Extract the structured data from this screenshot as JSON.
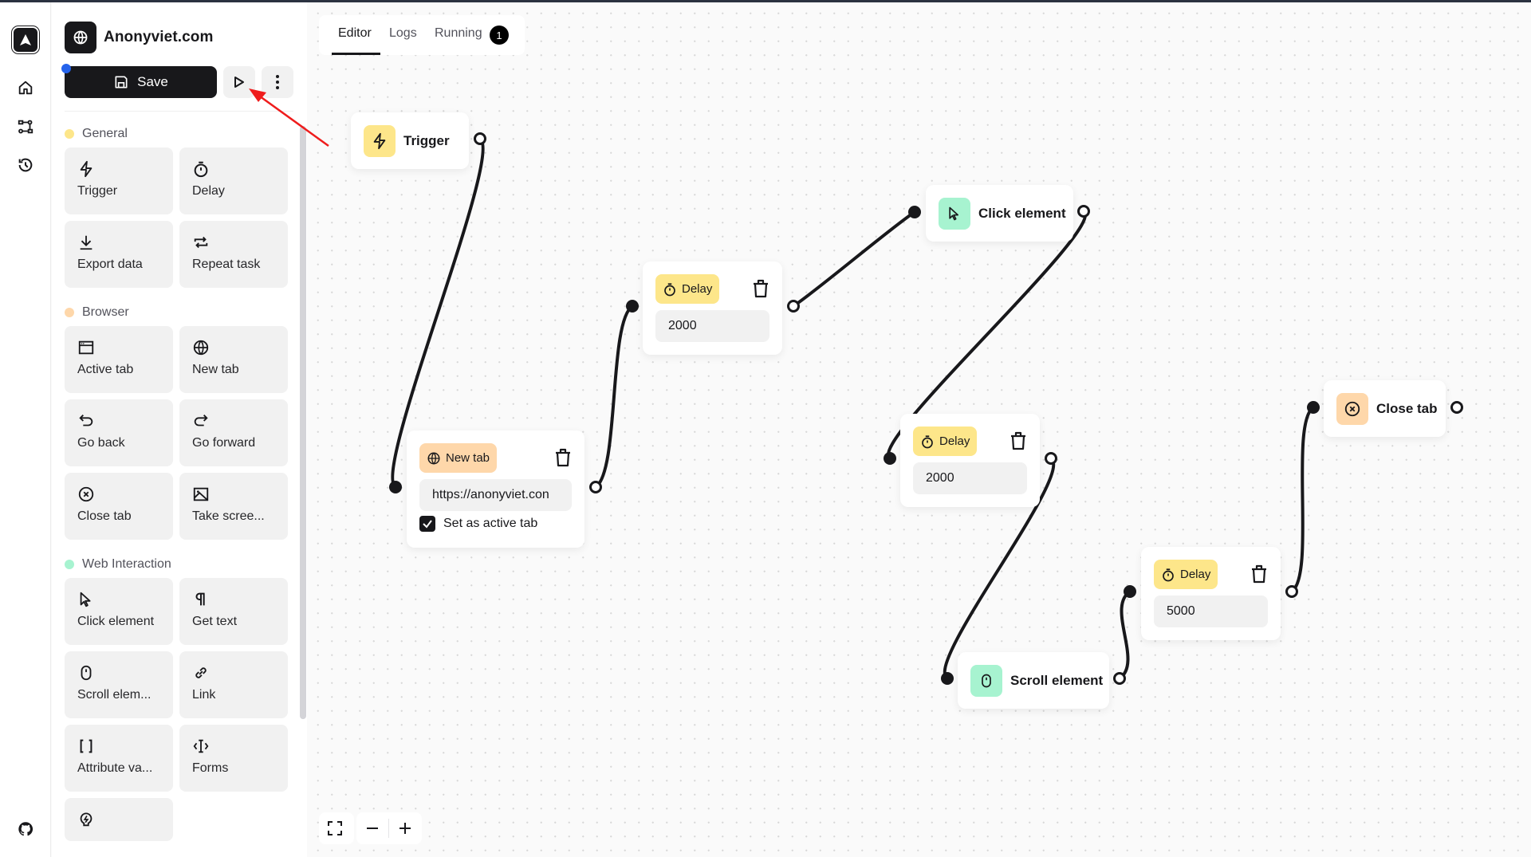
{
  "app": {
    "site_title": "Anonyviet.com",
    "site_icon": "globe-icon",
    "save_label": "Save",
    "run_icon": "play-icon",
    "more_icon": "more-vertical-icon"
  },
  "rail": {
    "logo": "automa-logo",
    "items": [
      {
        "name": "home",
        "icon": "home-icon"
      },
      {
        "name": "workflows",
        "icon": "workflow-icon"
      },
      {
        "name": "history",
        "icon": "history-icon"
      }
    ],
    "bottom": {
      "name": "github",
      "icon": "github-icon"
    }
  },
  "sidebar": {
    "sections": [
      {
        "label": "General",
        "color": "#fde68a",
        "blocks": [
          {
            "label": "Trigger",
            "icon": "lightning-icon"
          },
          {
            "label": "Delay",
            "icon": "stopwatch-icon"
          },
          {
            "label": "Export data",
            "icon": "download-icon"
          },
          {
            "label": "Repeat task",
            "icon": "repeat-icon"
          }
        ]
      },
      {
        "label": "Browser",
        "color": "#fed7aa",
        "blocks": [
          {
            "label": "Active tab",
            "icon": "window-icon"
          },
          {
            "label": "New tab",
            "icon": "globe-icon"
          },
          {
            "label": "Go back",
            "icon": "undo-icon"
          },
          {
            "label": "Go forward",
            "icon": "redo-icon"
          },
          {
            "label": "Close tab",
            "icon": "close-circle-icon"
          },
          {
            "label": "Take scree...",
            "icon": "image-icon"
          }
        ]
      },
      {
        "label": "Web Interaction",
        "color": "#a7f3d0",
        "blocks": [
          {
            "label": "Click element",
            "icon": "cursor-icon"
          },
          {
            "label": "Get text",
            "icon": "paragraph-icon"
          },
          {
            "label": "Scroll elem...",
            "icon": "mouse-icon"
          },
          {
            "label": "Link",
            "icon": "link-icon"
          },
          {
            "label": "Attribute va...",
            "icon": "brackets-icon"
          },
          {
            "label": "Forms",
            "icon": "text-cursor-input-icon"
          },
          {
            "label": "",
            "icon": "lightbulb-icon"
          }
        ]
      }
    ]
  },
  "tabs": {
    "items": [
      {
        "label": "Editor",
        "active": true
      },
      {
        "label": "Logs",
        "active": false
      },
      {
        "label": "Running",
        "active": false
      }
    ],
    "running_count": "1"
  },
  "nodes": {
    "trigger": {
      "label": "Trigger",
      "icon": "lightning-icon",
      "color": "#fde68a"
    },
    "new_tab": {
      "label": "New tab",
      "icon": "globe-icon",
      "color": "#fed7aa",
      "url": "https://anonyviet.con",
      "active_tab_label": "Set as active tab",
      "active_tab_checked": true
    },
    "delay1": {
      "label": "Delay",
      "icon": "stopwatch-icon",
      "color": "#fde68a",
      "value": "2000"
    },
    "click_element": {
      "label": "Click element",
      "icon": "cursor-icon",
      "color": "#a7f3d0"
    },
    "delay2": {
      "label": "Delay",
      "icon": "stopwatch-icon",
      "color": "#fde68a",
      "value": "2000"
    },
    "scroll_element": {
      "label": "Scroll element",
      "icon": "mouse-icon",
      "color": "#a7f3d0"
    },
    "delay3": {
      "label": "Delay",
      "icon": "stopwatch-icon",
      "color": "#fde68a",
      "value": "5000"
    },
    "close_tab": {
      "label": "Close tab",
      "icon": "close-circle-icon",
      "color": "#fed7aa"
    }
  },
  "connections": [
    [
      "trigger",
      "new_tab"
    ],
    [
      "new_tab",
      "delay1"
    ],
    [
      "delay1",
      "click_element"
    ],
    [
      "click_element",
      "delay2"
    ],
    [
      "delay2",
      "scroll_element"
    ],
    [
      "scroll_element",
      "delay3"
    ],
    [
      "delay3",
      "close_tab"
    ]
  ],
  "controls": {
    "fit_icon": "fullscreen-icon",
    "zoom_out_icon": "minus-icon",
    "zoom_in_icon": "plus-icon"
  },
  "annotation": {
    "arrow_color": "#ef1c1c",
    "target": "run-workflow-button"
  }
}
